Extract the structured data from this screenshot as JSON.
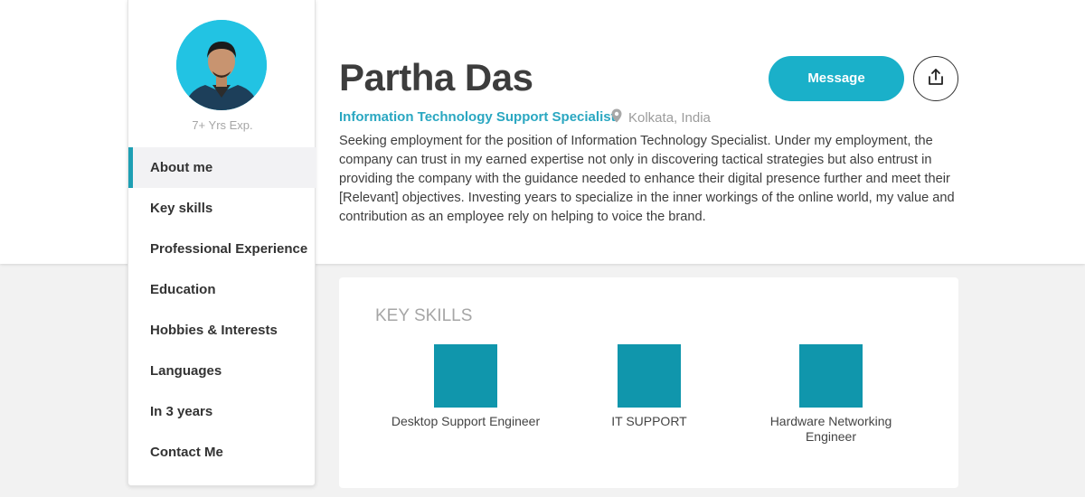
{
  "profile": {
    "experience": "7+ Yrs Exp.",
    "name": "Partha Das",
    "role": "Information Technology Support Specialist",
    "location": "Kolkata, India",
    "summary": "Seeking employment for the position of Information Technology Specialist. Under my employment, the company can trust in my earned expertise not only in discovering tactical strategies but also entrust in providing the company with the guidance needed to enhance their digital presence further and meet their [Relevant] objectives. Investing years to specialize in the inner workings of the online world, my value and contribution as an employee rely on helping to voice the brand."
  },
  "actions": {
    "message_label": "Message",
    "share_icon": "share-icon"
  },
  "nav": {
    "items": [
      {
        "label": "About me",
        "active": true
      },
      {
        "label": "Key skills"
      },
      {
        "label": "Professional Experience"
      },
      {
        "label": "Education"
      },
      {
        "label": "Hobbies & Interests"
      },
      {
        "label": "Languages"
      },
      {
        "label": "In 3 years"
      },
      {
        "label": "Contact Me"
      }
    ]
  },
  "skills": {
    "title": "KEY SKILLS",
    "items": [
      {
        "label": "Desktop Support Engineer"
      },
      {
        "label": "IT SUPPORT"
      },
      {
        "label": "Hardware Networking Engineer"
      }
    ]
  },
  "colors": {
    "accent": "#1ab0c9",
    "nav_active_bar": "#1e9fb3",
    "skill_tile": "#1096ac",
    "role_text": "#2aa7c1"
  }
}
